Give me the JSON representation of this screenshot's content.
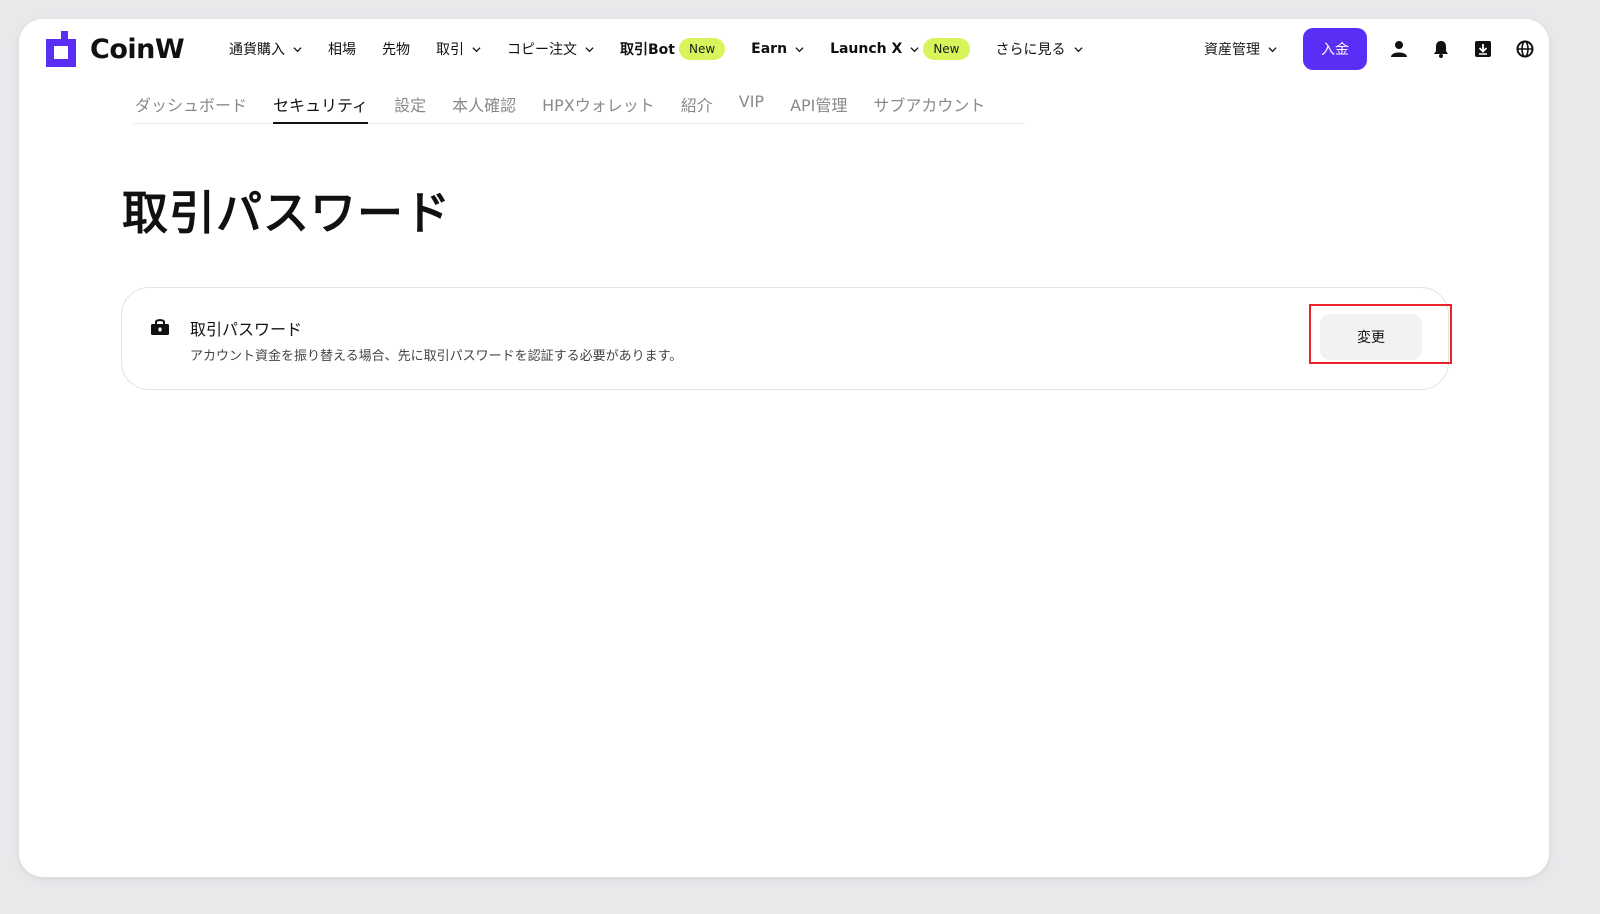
{
  "brand": {
    "name": "CoinW",
    "accent_color": "#5b2ef5",
    "badge_color": "#d7f55a"
  },
  "nav": {
    "items": [
      {
        "label": "通貨購入",
        "has_dropdown": true,
        "badge": ""
      },
      {
        "label": "相場",
        "has_dropdown": false,
        "badge": ""
      },
      {
        "label": "先物",
        "has_dropdown": false,
        "badge": ""
      },
      {
        "label": "取引",
        "has_dropdown": true,
        "badge": ""
      },
      {
        "label": "コピー注文",
        "has_dropdown": true,
        "badge": ""
      },
      {
        "label": "取引Bot",
        "has_dropdown": false,
        "badge": "New"
      },
      {
        "label": "Earn",
        "has_dropdown": true,
        "badge": ""
      },
      {
        "label": "Launch X",
        "has_dropdown": true,
        "badge": "New"
      },
      {
        "label": "さらに見る",
        "has_dropdown": true,
        "badge": ""
      }
    ]
  },
  "tools": {
    "asset_management": "資産管理",
    "deposit": "入金",
    "icons": [
      "user-icon",
      "bell-icon",
      "download-icon",
      "globe-icon"
    ]
  },
  "subnav": {
    "tabs": [
      {
        "label": "ダッシュボード",
        "active": false
      },
      {
        "label": "セキュリティ",
        "active": true
      },
      {
        "label": "設定",
        "active": false
      },
      {
        "label": "本人確認",
        "active": false
      },
      {
        "label": "HPXウォレット",
        "active": false
      },
      {
        "label": "紹介",
        "active": false
      },
      {
        "label": "VIP",
        "active": false
      },
      {
        "label": "API管理",
        "active": false
      },
      {
        "label": "サブアカウント",
        "active": false
      }
    ]
  },
  "page": {
    "title": "取引パスワード"
  },
  "card": {
    "icon": "lock-icon",
    "title": "取引パスワード",
    "description": "アカウント資金を振り替える場合、先に取引パスワードを認証する必要があります。",
    "button_label": "変更",
    "highlight_color": "#e8232a"
  }
}
